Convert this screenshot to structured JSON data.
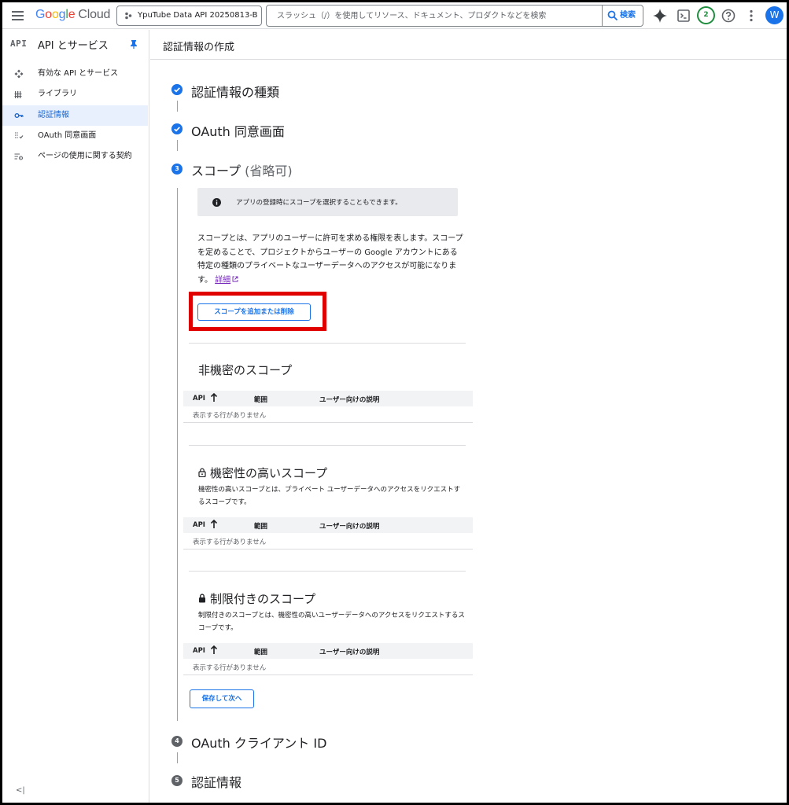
{
  "topbar": {
    "logo_google": [
      "G",
      "o",
      "o",
      "g",
      "l",
      "e"
    ],
    "logo_cloud": "Cloud",
    "project": "YpuTube Data API 20250813-B",
    "search_placeholder": "スラッシュ（/）を使用してリソース、ドキュメント、プロダクトなどを検索",
    "search_button": "検索",
    "notification_count": "2",
    "avatar_initial": "W"
  },
  "sidebar": {
    "api_logo": "API",
    "title": "API とサービス",
    "items": [
      {
        "label": "有効な API とサービス",
        "icon": "apis-icon"
      },
      {
        "label": "ライブラリ",
        "icon": "library-icon"
      },
      {
        "label": "認証情報",
        "icon": "key-icon",
        "active": true
      },
      {
        "label": "OAuth 同意画面",
        "icon": "consent-icon"
      },
      {
        "label": "ページの使用に関する契約",
        "icon": "agreement-icon"
      }
    ],
    "collapse": "<|"
  },
  "main": {
    "title": "認証情報の作成",
    "steps": [
      {
        "title": "認証情報の種類",
        "state": "done"
      },
      {
        "title": "OAuth 同意画面",
        "state": "done"
      },
      {
        "number": "3",
        "title": "スコープ",
        "optional": "(省略可)",
        "state": "current"
      },
      {
        "number": "4",
        "title": "OAuth クライアント ID",
        "state": "todo"
      },
      {
        "number": "5",
        "title": "認証情報",
        "state": "todo"
      }
    ],
    "info_text": "アプリの登録時にスコープを選択することもできます。",
    "description": "スコープとは、アプリのユーザーに許可を求める権限を表します。スコープを定めることで、プロジェクトからユーザーの Google アカウントにある特定の種類のプライベートなユーザーデータへのアクセスが可能になります。",
    "learn_more": "詳細",
    "add_scope_button": "スコープを追加または削除",
    "sections": [
      {
        "title": "非機密のスコープ",
        "desc": ""
      },
      {
        "title": "機密性の高いスコープ",
        "desc": "機密性の高いスコープとは、プライベート ユーザーデータへのアクセスをリクエストするスコープです。"
      },
      {
        "title": "制限付きのスコープ",
        "desc": "制限付きのスコープとは、機密性の高いユーザーデータへのアクセスをリクエストするスコープです。"
      }
    ],
    "table_headers": [
      "API",
      "範囲",
      "ユーザー向けの説明"
    ],
    "empty_text": "表示する行がありません",
    "save_button": "保存して次へ"
  },
  "colors": {
    "accent": "#1a73e8",
    "highlight": "#e00000",
    "active_bg": "#e8f0fe"
  }
}
